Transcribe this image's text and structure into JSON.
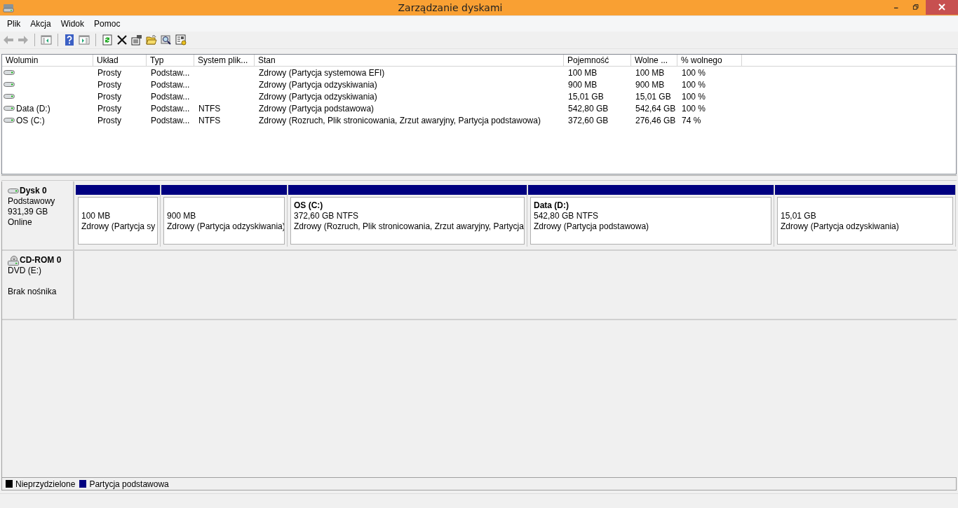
{
  "window": {
    "title": "Zarządzanie dyskami"
  },
  "menu": [
    "Plik",
    "Akcja",
    "Widok",
    "Pomoc"
  ],
  "toolbar": [
    {
      "kind": "back",
      "disabled": true
    },
    {
      "kind": "forward",
      "disabled": true
    },
    {
      "kind": "sep"
    },
    {
      "kind": "panel-left"
    },
    {
      "kind": "sep"
    },
    {
      "kind": "help"
    },
    {
      "kind": "panel-right"
    },
    {
      "kind": "sep"
    },
    {
      "kind": "refresh"
    },
    {
      "kind": "delete"
    },
    {
      "kind": "properties"
    },
    {
      "kind": "open"
    },
    {
      "kind": "zoom"
    },
    {
      "kind": "settings"
    }
  ],
  "volumes": {
    "columns": [
      "Wolumin",
      "Układ",
      "Typ",
      "System plik...",
      "Stan",
      "Pojemność",
      "Wolne ...",
      "% wolnego"
    ],
    "rows": [
      {
        "cells": [
          "",
          "Prosty",
          "Podstaw...",
          "",
          "Zdrowy (Partycja systemowa EFI)",
          "100 MB",
          "100 MB",
          "100 %"
        ]
      },
      {
        "cells": [
          "",
          "Prosty",
          "Podstaw...",
          "",
          "Zdrowy (Partycja odzyskiwania)",
          "900 MB",
          "900 MB",
          "100 %"
        ]
      },
      {
        "cells": [
          "",
          "Prosty",
          "Podstaw...",
          "",
          "Zdrowy (Partycja odzyskiwania)",
          "15,01 GB",
          "15,01 GB",
          "100 %"
        ]
      },
      {
        "cells": [
          "Data (D:)",
          "Prosty",
          "Podstaw...",
          "NTFS",
          "Zdrowy (Partycja podstawowa)",
          "542,80 GB",
          "542,64 GB",
          "100 %"
        ]
      },
      {
        "cells": [
          "OS (C:)",
          "Prosty",
          "Podstaw...",
          "NTFS",
          "Zdrowy (Rozruch, Plik stronicowania, Zrzut awaryjny, Partycja podstawowa)",
          "372,60 GB",
          "276,46 GB",
          "74 %"
        ]
      }
    ]
  },
  "disks": [
    {
      "kind": "disk",
      "name": "Dysk 0",
      "lines": [
        "Podstawowy",
        "931,39 GB",
        "Online"
      ],
      "partitions": [
        {
          "color": "#000080",
          "size": "100 MB",
          "status": "Zdrowy (Partycja sy"
        },
        {
          "color": "#000080",
          "size": "900 MB",
          "status": "Zdrowy (Partycja odzyskiwania)"
        },
        {
          "color": "#000080",
          "title": "OS  (C:)",
          "size": "372,60 GB NTFS",
          "status": "Zdrowy (Rozruch, Plik stronicowania, Zrzut awaryjny, Partycja"
        },
        {
          "color": "#000080",
          "title": "Data  (D:)",
          "size": "542,80 GB NTFS",
          "status": "Zdrowy (Partycja podstawowa)"
        },
        {
          "color": "#000080",
          "size": "15,01 GB",
          "status": "Zdrowy (Partycja odzyskiwania)"
        }
      ]
    },
    {
      "kind": "cdrom",
      "name": "CD-ROM 0",
      "lines": [
        "DVD (E:)",
        "Brak nośnika"
      ]
    }
  ],
  "legend": [
    {
      "label": "Nieprzydzielone",
      "color": "#000000"
    },
    {
      "label": "Partycja podstawowa",
      "color": "#000080"
    }
  ]
}
